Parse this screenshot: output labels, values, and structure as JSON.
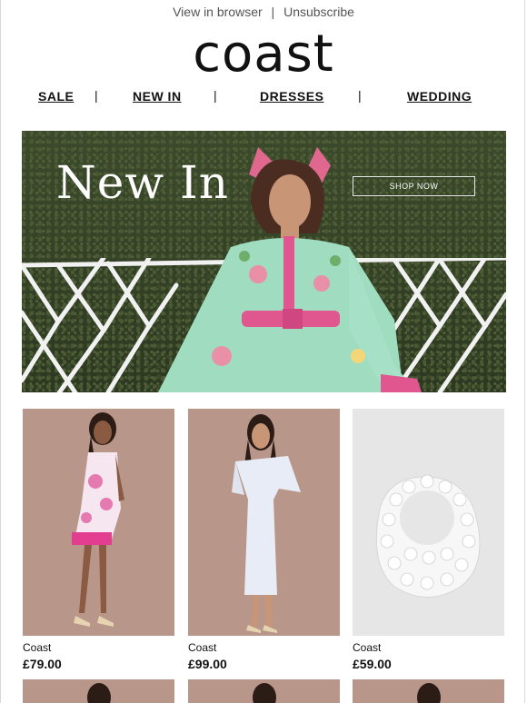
{
  "preheader": {
    "view_in_browser": "View in browser",
    "separator": "|",
    "unsubscribe": "Unsubscribe"
  },
  "brand": {
    "logo_text": "coast"
  },
  "nav": {
    "items": [
      {
        "label": "SALE"
      },
      {
        "label": "NEW IN"
      },
      {
        "label": "DRESSES"
      },
      {
        "label": "WEDDING"
      }
    ],
    "divider": "|"
  },
  "hero": {
    "headline": "New In",
    "cta_label": "SHOP NOW"
  },
  "products": [
    {
      "brand": "Coast",
      "price": "£79.00"
    },
    {
      "brand": "Coast",
      "price": "£99.00"
    },
    {
      "brand": "Coast",
      "price": "£59.00"
    }
  ],
  "colors": {
    "product_bg_pink": "#b8968a",
    "product_bg_grey": "#e6e6e6",
    "hero_hedge": "#34422a"
  }
}
